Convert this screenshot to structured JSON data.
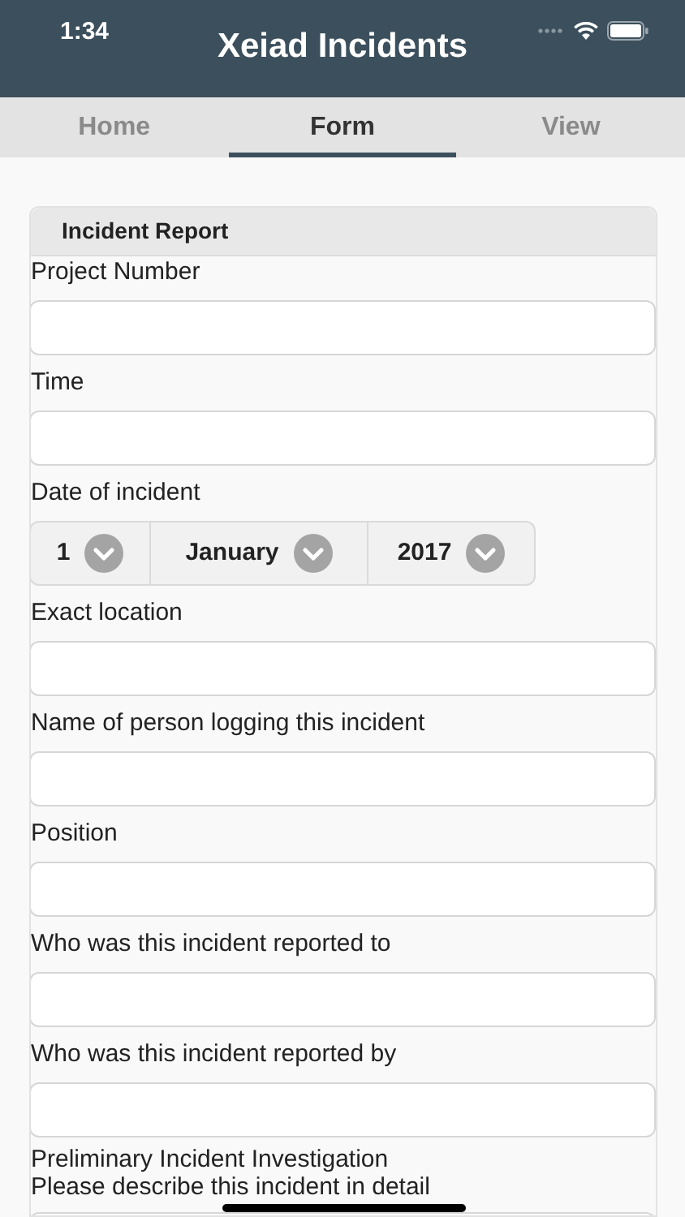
{
  "status_bar": {
    "time": "1:34"
  },
  "app_bar": {
    "title": "Xeiad Incidents"
  },
  "tabs": [
    {
      "label": "Home",
      "selected": false
    },
    {
      "label": "Form",
      "selected": true
    },
    {
      "label": "View",
      "selected": false
    }
  ],
  "form": {
    "title": "Incident Report",
    "fields": [
      {
        "kind": "text",
        "label": "Project Number"
      },
      {
        "kind": "text",
        "label": "Time"
      },
      {
        "kind": "date",
        "label": "Date of incident",
        "parts": [
          "1",
          "January",
          "2017"
        ]
      },
      {
        "kind": "text",
        "label": "Exact location"
      },
      {
        "kind": "text",
        "label": "Name of person logging this incident"
      },
      {
        "kind": "text",
        "label": "Position"
      },
      {
        "kind": "text",
        "label": "Who was this incident reported to"
      },
      {
        "kind": "text",
        "label": "Who was this incident reported by"
      },
      {
        "kind": "text",
        "label": "Preliminary Incident Investigation",
        "hint": "Please describe this incident in detail"
      }
    ]
  }
}
